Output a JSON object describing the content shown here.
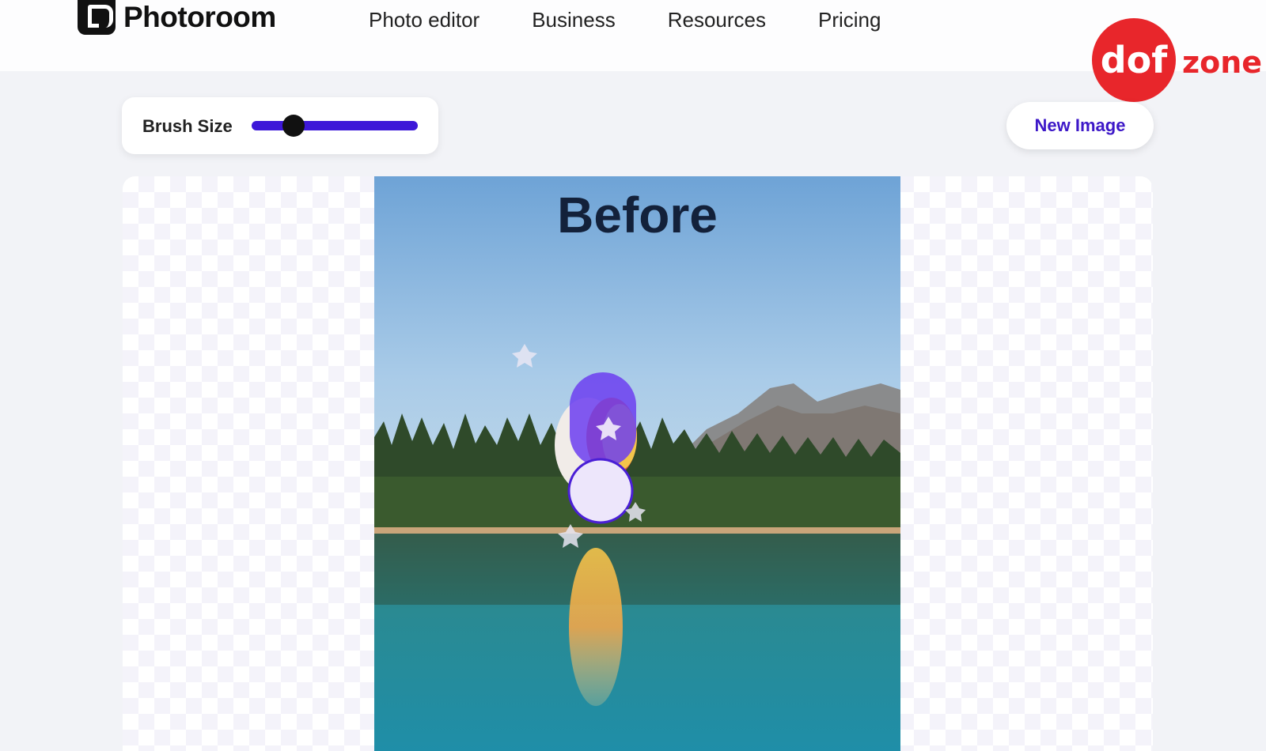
{
  "header": {
    "brand": "Photoroom",
    "nav": [
      {
        "label": "Photo editor"
      },
      {
        "label": "Business"
      },
      {
        "label": "Resources"
      },
      {
        "label": "Pricing"
      }
    ]
  },
  "watermark": {
    "circle_text": "dof",
    "side_text": "zone",
    "color": "#e8262b"
  },
  "toolbar": {
    "brush_size_label": "Brush Size",
    "brush_size_fraction": 0.25,
    "new_image_label": "New Image"
  },
  "canvas": {
    "before_label": "Before"
  },
  "colors": {
    "accent": "#3d18d8",
    "background": "#f2f3f7"
  }
}
